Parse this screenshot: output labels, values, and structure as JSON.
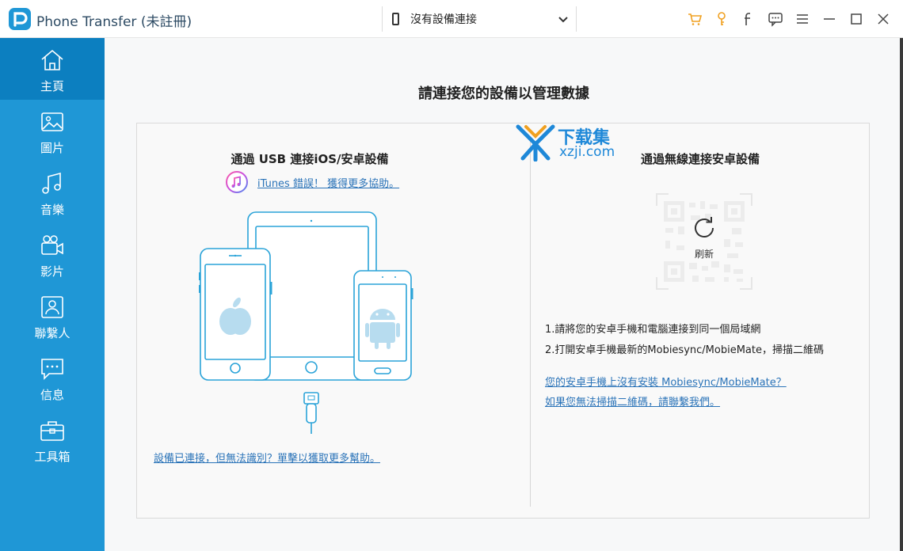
{
  "app": {
    "title": "Phone Transfer (未註冊)"
  },
  "device_selector": {
    "label": "沒有設備連接"
  },
  "toolbar_icons": [
    "cart-icon",
    "key-icon",
    "facebook-icon",
    "feedback-icon",
    "menu-icon",
    "minimize-icon",
    "maximize-icon",
    "close-icon"
  ],
  "sidebar": {
    "items": [
      {
        "label": "主頁",
        "icon": "home-icon",
        "active": true
      },
      {
        "label": "圖片",
        "icon": "image-icon"
      },
      {
        "label": "音樂",
        "icon": "music-icon"
      },
      {
        "label": "影片",
        "icon": "video-icon"
      },
      {
        "label": "聯繫人",
        "icon": "contacts-icon"
      },
      {
        "label": "信息",
        "icon": "message-icon"
      },
      {
        "label": "工具箱",
        "icon": "toolbox-icon"
      }
    ]
  },
  "main": {
    "heading": "請連接您的設備以管理數據",
    "usb": {
      "title": "通過 USB 連接iOS/安卓設備",
      "itunes_link": "iTunes 錯誤！ 獲得更多協助。",
      "help_link": "設備已連接，但無法識別？單擊以獲取更多幫助。"
    },
    "wireless": {
      "title": "通過無線連接安卓設備",
      "refresh_label": "刷新",
      "step1": "1.請將您的安卓手機和電腦連接到同一個局域網",
      "step2": "2.打開安卓手機最新的Mobiesync/MobieMate，掃描二維碼",
      "link_no_app": "您的安卓手機上沒有安裝 Mobiesync/MobieMate？",
      "link_contact": "如果您無法掃描二維碼，請聯繫我們。"
    },
    "watermark": {
      "line1": "下载集",
      "line2": "xzji.com"
    }
  },
  "colors": {
    "sidebar": "#1f97d6",
    "sidebar_active": "#0c7fc0",
    "link": "#2a73b8",
    "device_outline": "#2aa3d8",
    "accent_orange": "#f0a020"
  }
}
